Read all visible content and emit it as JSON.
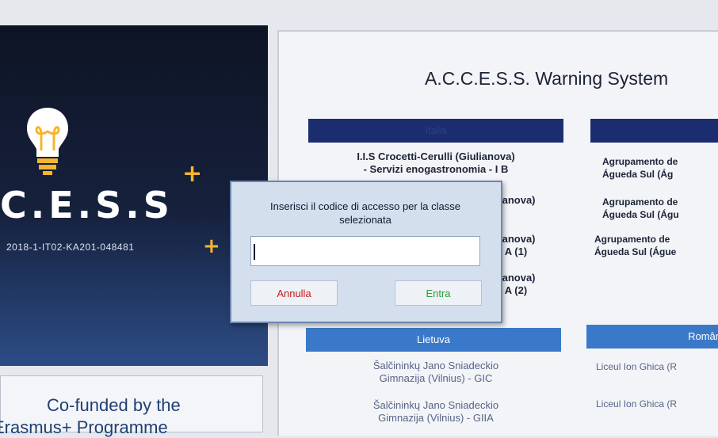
{
  "project": {
    "logo_text": "C.E.S.S",
    "code": "2018-1-IT02-KA201-048481",
    "cofunded_line1": "Co-funded by the",
    "cofunded_line2": "Erasmus+ Programme"
  },
  "app": {
    "title": "A.C.C.E.S.S. Warning System"
  },
  "countries": {
    "italia": {
      "header": "Italia",
      "classes": [
        {
          "line1": "I.I.S Crocetti-Cerulli (Giulianova)",
          "line2": "- Servizi enogastronomia - I B"
        },
        {
          "line1": "ianova)",
          "line2": ""
        },
        {
          "line1": "ianova)",
          "line2": "I A (1)"
        },
        {
          "line1": "ianova)",
          "line2": "I A (2)"
        }
      ]
    },
    "portugal": {
      "header": "",
      "classes": [
        {
          "line1": "Agrupamento de",
          "line2": "Águeda Sul (Ág"
        },
        {
          "line1": "Agrupamento de",
          "line2": "Águeda Sul (Águ"
        },
        {
          "line1": "Agrupamento de",
          "line2": "Águeda Sul (Águe"
        }
      ]
    },
    "lietuva": {
      "header": "Lietuva",
      "classes": [
        {
          "line1": "Šalčininkų Jano Sniadeckio",
          "line2": "Gimnazija (Vilnius) - GIC"
        },
        {
          "line1": "Šalčininkų Jano Sniadeckio",
          "line2": "Gimnazija (Vilnius) - GIIA"
        }
      ]
    },
    "romania": {
      "header": "Român",
      "classes": [
        {
          "line1": "Liceul Ion Ghica (R"
        },
        {
          "line1": "Liceul Ion Ghica (R"
        }
      ]
    }
  },
  "dialog": {
    "message": "Inserisci il codice di accesso per la classe selezionata",
    "input_value": "",
    "cancel_label": "Annulla",
    "enter_label": "Entra"
  },
  "colors": {
    "accent_yellow": "#f5b52e",
    "header_dark_blue": "#1c2d6f",
    "header_light_blue": "#3a79c9",
    "cancel_red": "#c21f1f",
    "enter_green": "#27a038"
  }
}
